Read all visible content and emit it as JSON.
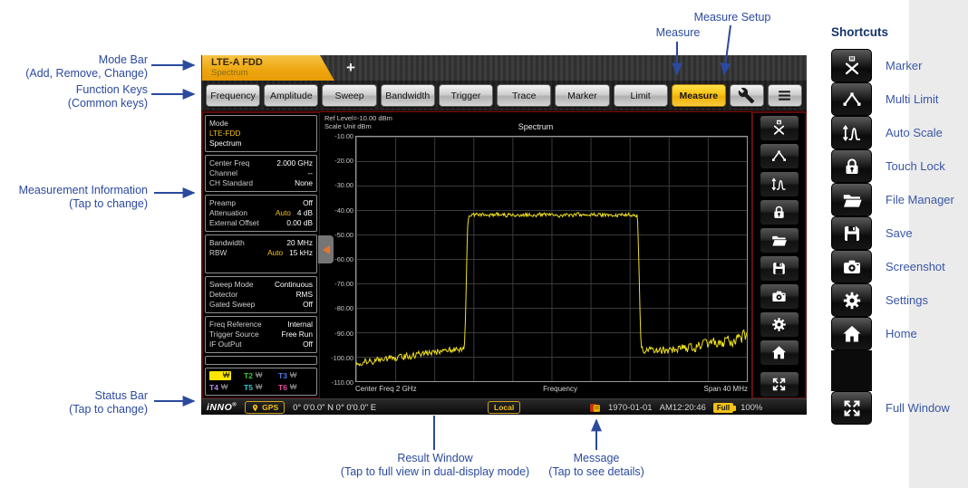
{
  "annotations": {
    "mode_bar": {
      "line1": "Mode Bar",
      "line2": "(Add, Remove, Change)"
    },
    "function_keys": {
      "line1": "Function Keys",
      "line2": "(Common keys)"
    },
    "measurement_info": {
      "line1": "Measurement Information",
      "line2": "(Tap to change)"
    },
    "status_bar": {
      "line1": "Status Bar",
      "line2": "(Tap to change)"
    },
    "measure": {
      "line1": "Measure"
    },
    "measure_setup": {
      "line1": "Measure Setup"
    },
    "result_window": {
      "line1": "Result Window",
      "line2": "(Tap to full view in dual-display mode)"
    },
    "message": {
      "line1": "Message",
      "line2": "(Tap to see details)"
    }
  },
  "device": {
    "mode_bar": {
      "tab_title": "LTE-A FDD",
      "tab_subtitle": "Spectrum",
      "add_tab": "+"
    },
    "function_keys": [
      "Frequency",
      "Amplitude",
      "Sweep",
      "Bandwidth",
      "Trigger",
      "Trace",
      "Marker",
      "Limit",
      "Measure"
    ],
    "active_function_key": "Measure",
    "info_panels": [
      {
        "name": "mode",
        "lines": [
          {
            "text": "Mode",
            "cls": ""
          },
          {
            "text": "LTE-FDD",
            "cls": "accent"
          },
          {
            "text": "Spectrum",
            "cls": "value"
          }
        ]
      },
      {
        "name": "frequency",
        "rows": [
          {
            "l": "Center Freq",
            "v": "2.000 GHz"
          },
          {
            "l": "Channel",
            "v": "--"
          },
          {
            "l": "CH Standard",
            "v": "None"
          }
        ]
      },
      {
        "name": "amplitude",
        "rows": [
          {
            "l": "Preamp",
            "v": "Off"
          },
          {
            "l": "Attenuation",
            "m": "Auto",
            "v": "4 dB"
          },
          {
            "l": "External Offset",
            "v": "0.00 dB"
          }
        ]
      },
      {
        "name": "bandwidth",
        "tall": true,
        "rows": [
          {
            "l": "Bandwidth",
            "v": "20 MHz"
          },
          {
            "l": "RBW",
            "m": "Auto",
            "v": "15 kHz"
          }
        ]
      },
      {
        "name": "sweep",
        "rows": [
          {
            "l": "Sweep Mode",
            "v": "Continuous"
          },
          {
            "l": "Detector",
            "v": "RMS"
          },
          {
            "l": "Gated Sweep",
            "v": "Off"
          }
        ]
      },
      {
        "name": "trigger",
        "rows": [
          {
            "l": "Freq Reference",
            "v": "Internal"
          },
          {
            "l": "Trigger Source",
            "v": "Free Run"
          },
          {
            "l": "IF OutPut",
            "v": "Off"
          }
        ]
      },
      {
        "name": "spare",
        "rows": []
      }
    ],
    "traces": [
      {
        "id": "T1",
        "mode": "₩",
        "color": "#ffe600",
        "active": true
      },
      {
        "id": "T2",
        "mode": "₩",
        "color": "#35cc35"
      },
      {
        "id": "T3",
        "mode": "₩",
        "color": "#4d79e8"
      },
      {
        "id": "T4",
        "mode": "₩",
        "color": "#bb86ee"
      },
      {
        "id": "T5",
        "mode": "₩",
        "color": "#37c8c8"
      },
      {
        "id": "T6",
        "mode": "₩",
        "color": "#e0509a"
      }
    ],
    "chart_labels": {
      "ref_level": "Ref Level=-10.00 dBm",
      "scale_unit": "Scale Unit  dBm",
      "title": "Spectrum",
      "y_ticks": [
        "-10.00",
        "-20.00",
        "-30.00",
        "-40.00",
        "-50.00",
        "-60.00",
        "-70.00",
        "-80.00",
        "-90.00",
        "-100.00",
        "-110.00"
      ],
      "x_left": "Center Freq 2 GHz",
      "x_center": "Frequency",
      "x_right": "Span 40 MHz"
    },
    "side_icons": [
      "marker",
      "multi-limit",
      "auto-scale",
      "touch-lock",
      "file-manager",
      "save",
      "screenshot",
      "settings",
      "home",
      "full-window"
    ],
    "status_bar": {
      "logo": "iNNO",
      "gps": "GPS",
      "coords": "0°  0'0.0\" N  0°  0'0.0\" E",
      "local": "Local",
      "date": "1970-01-01",
      "time": "AM12:20:46",
      "battery": "Full",
      "percent": "100%"
    }
  },
  "shortcuts": {
    "title": "Shortcuts",
    "items": [
      {
        "icon": "marker",
        "label": "Marker"
      },
      {
        "icon": "multi-limit",
        "label": "Multi Limit"
      },
      {
        "icon": "auto-scale",
        "label": "Auto Scale"
      },
      {
        "icon": "touch-lock",
        "label": "Touch Lock"
      },
      {
        "icon": "file-manager",
        "label": "File Manager"
      },
      {
        "icon": "save",
        "label": "Save"
      },
      {
        "icon": "screenshot",
        "label": "Screenshot"
      },
      {
        "icon": "settings",
        "label": "Settings"
      },
      {
        "icon": "home",
        "label": "Home"
      },
      {
        "icon": "full-window",
        "label": "Full Window"
      }
    ]
  },
  "chart_data": {
    "type": "line",
    "title": "Spectrum",
    "xlabel": "Frequency",
    "ylabel": "dBm",
    "ref_level_dbm": -10.0,
    "scale_unit": "dBm",
    "ylim": [
      -110,
      -10
    ],
    "y_tick_step": 10,
    "x_center": "2 GHz",
    "x_span": "40 MHz",
    "grid": true,
    "series": [
      {
        "name": "T1",
        "mode": "W",
        "color": "#f2e21c",
        "shape": {
          "noise_floor_left_dbm": [
            -102.5,
            -96.5
          ],
          "noise_floor_right_dbm": [
            -97.5,
            -91.5
          ],
          "plateau_dbm": -42,
          "plateau_span_frac": [
            0.285,
            0.72
          ],
          "noise_jitter_db": 2.0,
          "plateau_jitter_db": 1.1
        }
      }
    ]
  }
}
